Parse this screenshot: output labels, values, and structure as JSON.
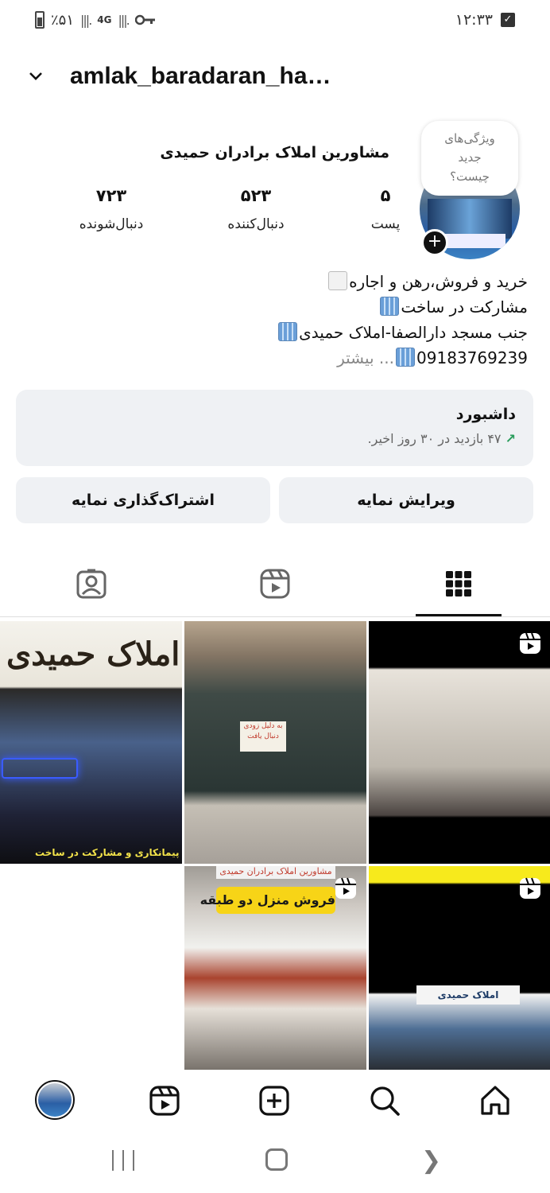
{
  "status_bar": {
    "battery": "٪۵۱",
    "network": "4G",
    "time": "۱۲:۳۳"
  },
  "header": {
    "username": "amlak_baradaran_ha…",
    "chevron_icon": "chevron-down-icon"
  },
  "profile": {
    "display_name": "مشاورین املاک برادران حمیدی",
    "bubble_line1": "ویژگی‌های",
    "bubble_line2": "جدید",
    "bubble_line3": "چیست؟",
    "stats": {
      "posts_count": "۵",
      "posts_label": "پست",
      "followers_count": "۵۲۳",
      "followers_label": "دنبال‌کننده",
      "following_count": "۷۲۳",
      "following_label": "دنبال‌شونده"
    },
    "bio": {
      "line1": "خرید و فروش،رهن و اجاره",
      "line2": "مشارکت در ساخت",
      "line3": "جنب مسجد دارالصفا-املاک حمیدی",
      "line4_phone": "09183769239",
      "more": "... بیشتر"
    }
  },
  "dashboard": {
    "title": "داشبورد",
    "count": "۴۷",
    "subtitle": "بازدید در ۳۰ روز اخیر."
  },
  "buttons": {
    "edit": "ویرایش نمایه",
    "share": "اشتراک‌گذاری نمایه"
  },
  "tabs": {
    "grid_icon": "grid-icon",
    "reels_icon": "reels-icon",
    "tagged_icon": "tagged-person-icon"
  },
  "grid": {
    "tile1_sign": "املاک حمیدی",
    "tile1_caption": "پیمانکاری و مشارکت در ساخت",
    "tile2_note": "به دلیل زودی دنبال یافت",
    "tile4_top": "مشاورین املاک برادران حمیدی",
    "tile4_banner": "فروش منزل دو طبقه",
    "tile5_sign": "املاک حمیدی"
  },
  "bottom_nav": {
    "home_icon": "home-icon",
    "search_icon": "search-icon",
    "create_icon": "plus-square-icon",
    "reels_icon": "reels-icon",
    "profile_icon": "profile-avatar"
  },
  "colors": {
    "accent_green": "#2a9d5c",
    "button_bg": "#eff1f4"
  }
}
